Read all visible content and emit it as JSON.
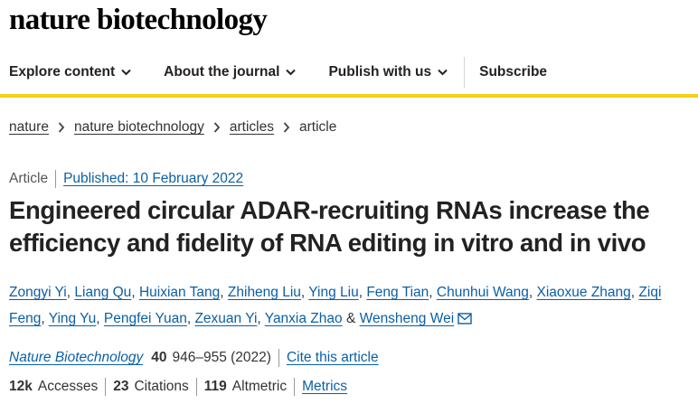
{
  "site": {
    "logo": "nature biotechnology"
  },
  "nav": {
    "items": [
      {
        "label": "Explore content"
      },
      {
        "label": "About the journal"
      },
      {
        "label": "Publish with us"
      }
    ],
    "subscribe": "Subscribe"
  },
  "breadcrumb": [
    "nature",
    "nature biotechnology",
    "articles",
    "article"
  ],
  "article": {
    "type": "Article",
    "published": "Published: 10 February 2022",
    "title": "Engineered circular ADAR-recruiting RNAs increase the efficiency and fidelity of RNA editing in vitro and in vivo",
    "authors": [
      "Zongyi Yi",
      "Liang Qu",
      "Huixian Tang",
      "Zhiheng Liu",
      "Ying Liu",
      "Feng Tian",
      "Chunhui Wang",
      "Xiaoxue Zhang",
      "Ziqi Feng",
      "Ying Yu",
      "Pengfei Yuan",
      "Zexuan Yi",
      "Yanxia Zhao",
      "Wensheng Wei"
    ],
    "author_separator": ", ",
    "last_separator": " & "
  },
  "citation": {
    "journal": "Nature Biotechnology",
    "volume": "40",
    "pages_year": "946–955 (2022)",
    "cite_link": "Cite this article"
  },
  "metrics": {
    "accesses_value": "12k",
    "accesses_label": "Accesses",
    "citations_value": "23",
    "citations_label": "Citations",
    "altmetric_value": "119",
    "altmetric_label": "Altmetric",
    "metrics_link": "Metrics"
  },
  "colors": {
    "accent_bar": "#f3d11a",
    "link": "#0b5fa6"
  },
  "icons": {
    "nav_chevron": "chevron-down-icon",
    "breadcrumb_sep": "chevron-right-icon",
    "corresponding": "envelope-icon"
  }
}
